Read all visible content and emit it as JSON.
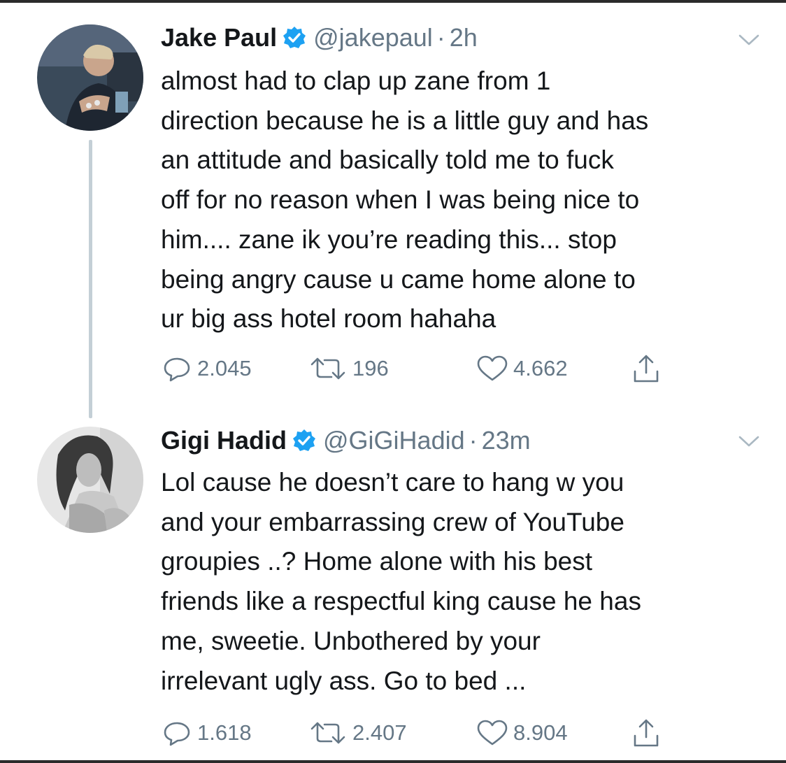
{
  "tweets": [
    {
      "name": "Jake Paul",
      "handle": "@jakepaul",
      "separator": "·",
      "time": "2h",
      "text": "almost had to clap up zane from 1\ndirection because he is a little guy and has\nan attitude and basically told me to fuck\noff for no reason when I was being nice to\nhim.... zane ik you’re reading this... stop\nbeing angry cause u came home alone to\nur big ass hotel room hahaha",
      "replies": "2.045",
      "retweets": "196",
      "likes": "4.662"
    },
    {
      "name": "Gigi Hadid",
      "handle": "@GiGiHadid",
      "separator": "·",
      "time": "23m",
      "text": "Lol cause he doesn’t care to hang w you\nand your embarrassing crew of YouTube\ngroupies ..? Home alone with his best\nfriends like a respectful king cause he has\nme, sweetie. Unbothered by your\nirrelevant ugly ass. Go to bed ...",
      "replies": "1.618",
      "retweets": "2.407",
      "likes": "8.904"
    }
  ],
  "icons": {
    "verified": "verified-badge-icon",
    "caret": "chevron-down-icon",
    "reply": "reply-bubble-icon",
    "retweet": "retweet-arrows-icon",
    "like": "heart-icon",
    "share": "share-upload-icon"
  },
  "colors": {
    "text": "#14171a",
    "secondary": "#657786",
    "verified": "#1da1f2",
    "thread_line": "#c4cfd6"
  }
}
